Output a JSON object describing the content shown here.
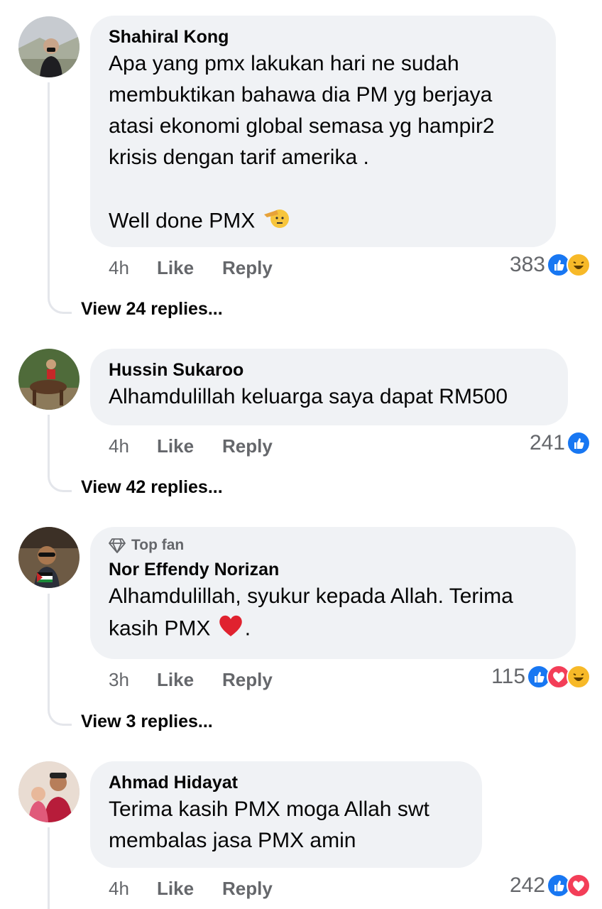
{
  "comments": [
    {
      "author": "Shahiral Kong",
      "text": "Apa yang pmx lakukan hari ne sudah\nmembuktikan bahawa dia PM yg berjaya\natasi ekonomi global semasa yg hampir2\nkrisis dengan tarif amerika .\n\nWell done PMX",
      "emoji": "saluting-face",
      "time": "4h",
      "like_label": "Like",
      "reply_label": "Reply",
      "reaction_count": "383",
      "reactions": [
        "like",
        "haha"
      ],
      "view_replies": "View 24 replies..."
    },
    {
      "author": "Hussin Sukaroo",
      "text": "Alhamdulillah keluarga saya dapat RM500",
      "time": "4h",
      "like_label": "Like",
      "reply_label": "Reply",
      "reaction_count": "241",
      "reactions": [
        "like"
      ],
      "view_replies": "View 42 replies..."
    },
    {
      "badge": "Top fan",
      "author": "Nor Effendy Norizan",
      "text": "Alhamdulillah, syukur kepada Allah. Terima\nkasih PMX",
      "emoji": "red-heart",
      "text_after": ".",
      "time": "3h",
      "like_label": "Like",
      "reply_label": "Reply",
      "reaction_count": "115",
      "reactions": [
        "like",
        "love",
        "haha"
      ],
      "view_replies": "View 3 replies..."
    },
    {
      "author": "Ahmad Hidayat",
      "text": "Terima kasih PMX moga Allah swt\nmembalas jasa PMX amin",
      "time": "4h",
      "like_label": "Like",
      "reply_label": "Reply",
      "reaction_count": "242",
      "reactions": [
        "like",
        "love"
      ]
    }
  ],
  "colors": {
    "bubble": "#f0f2f5",
    "like_blue": "#1877f2",
    "love_red": "#f33e58",
    "haha_yellow": "#f7b928",
    "muted_text": "#65676b"
  }
}
